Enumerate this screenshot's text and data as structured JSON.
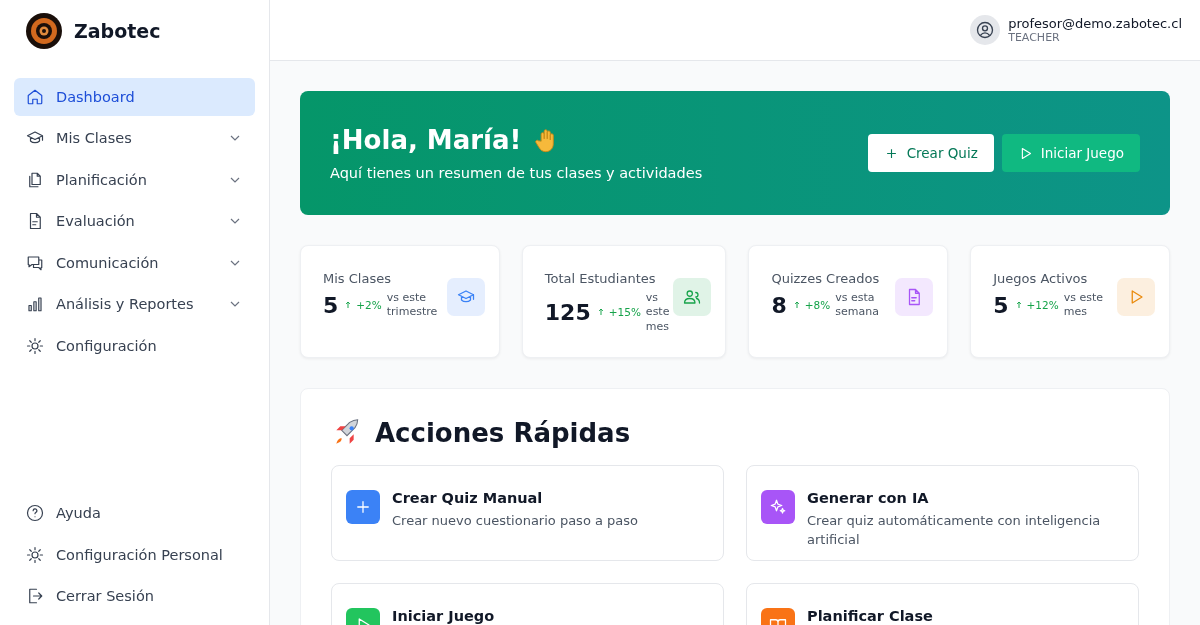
{
  "brand": {
    "name": "Zabotec"
  },
  "sidebar": {
    "items": [
      {
        "label": "Dashboard",
        "kind": "link",
        "selected": true
      },
      {
        "label": "Mis Clases",
        "kind": "group",
        "selected": false
      },
      {
        "label": "Planificación",
        "kind": "group",
        "selected": false
      },
      {
        "label": "Evaluación",
        "kind": "group",
        "selected": false
      },
      {
        "label": "Comunicación",
        "kind": "group",
        "selected": false
      },
      {
        "label": "Análisis y Reportes",
        "kind": "group",
        "selected": false
      },
      {
        "label": "Configuración",
        "kind": "link",
        "selected": false
      }
    ],
    "footer_items": [
      {
        "label": "Ayuda"
      },
      {
        "label": "Configuración Personal"
      },
      {
        "label": "Cerrar Sesión"
      }
    ]
  },
  "user": {
    "email": "profesor@demo.zabotec.cl",
    "role": "TEACHER"
  },
  "welcome": {
    "title": "¡Hola, María!",
    "subtitle": "Aquí tienes un resumen de tus clases y actividades",
    "buttons": [
      {
        "label": "Crear Quiz"
      },
      {
        "label": "Iniciar Juego"
      }
    ]
  },
  "stats": [
    {
      "label": "Mis Clases",
      "value": "5",
      "change": "+2%",
      "period": "vs este trimestre",
      "color": "#3b82f6"
    },
    {
      "label": "Total Estudiantes",
      "value": "125",
      "change": "+15%",
      "period": "vs este mes",
      "color": "#16a34a"
    },
    {
      "label": "Quizzes Creados",
      "value": "8",
      "change": "+8%",
      "period": "vs esta semana",
      "color": "#a855f7"
    },
    {
      "label": "Juegos Activos",
      "value": "5",
      "change": "+12%",
      "period": "vs este mes",
      "color": "#ea8a0c"
    }
  ],
  "quick_actions": {
    "title": "Acciones Rápidas",
    "items": [
      {
        "title": "Crear Quiz Manual",
        "description": "Crear nuevo cuestionario paso a paso",
        "color": "#3b82f6"
      },
      {
        "title": "Generar con IA",
        "description": "Crear quiz automáticamente con inteligencia artificial",
        "color": "#a855f7"
      },
      {
        "title": "Iniciar Juego",
        "color": "#22c55e"
      },
      {
        "title": "Planificar Clase",
        "color": "#f97316"
      }
    ]
  }
}
